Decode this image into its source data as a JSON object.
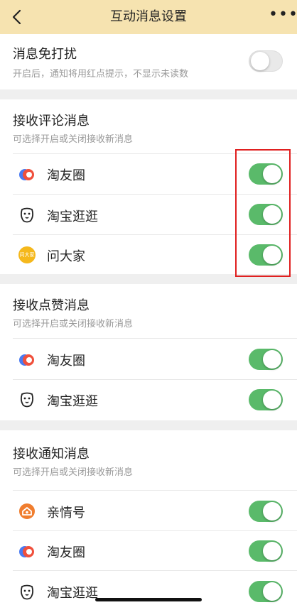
{
  "header": {
    "title": "互动消息设置",
    "more": "•••"
  },
  "dnd": {
    "title": "消息免打扰",
    "subtitle": "开启后，通知将用红点提示，不显示未读数",
    "on": false
  },
  "comments": {
    "title": "接收评论消息",
    "subtitle": "可选择开启或关闭接收新消息",
    "items": [
      {
        "label": "淘友圈",
        "icon": "taoyouquan-icon",
        "on": true
      },
      {
        "label": "淘宝逛逛",
        "icon": "guangguang-icon",
        "on": true
      },
      {
        "label": "问大家",
        "icon": "wendajia-icon",
        "badge": "问大家",
        "on": true
      }
    ]
  },
  "likes": {
    "title": "接收点赞消息",
    "subtitle": "可选择开启或关闭接收新消息",
    "items": [
      {
        "label": "淘友圈",
        "icon": "taoyouquan-icon",
        "on": true
      },
      {
        "label": "淘宝逛逛",
        "icon": "guangguang-icon",
        "on": true
      }
    ]
  },
  "notify": {
    "title": "接收通知消息",
    "subtitle": "可选择开启或关闭接收新消息",
    "items": [
      {
        "label": "亲情号",
        "icon": "qinqinghao-icon",
        "on": true
      },
      {
        "label": "淘友圈",
        "icon": "taoyouquan-icon",
        "on": true
      },
      {
        "label": "淘宝逛逛",
        "icon": "guangguang-icon",
        "on": true
      }
    ]
  },
  "colors": {
    "header_bg": "#f6e3b0",
    "toggle_on": "#5aba6a",
    "highlight": "#e02020"
  }
}
